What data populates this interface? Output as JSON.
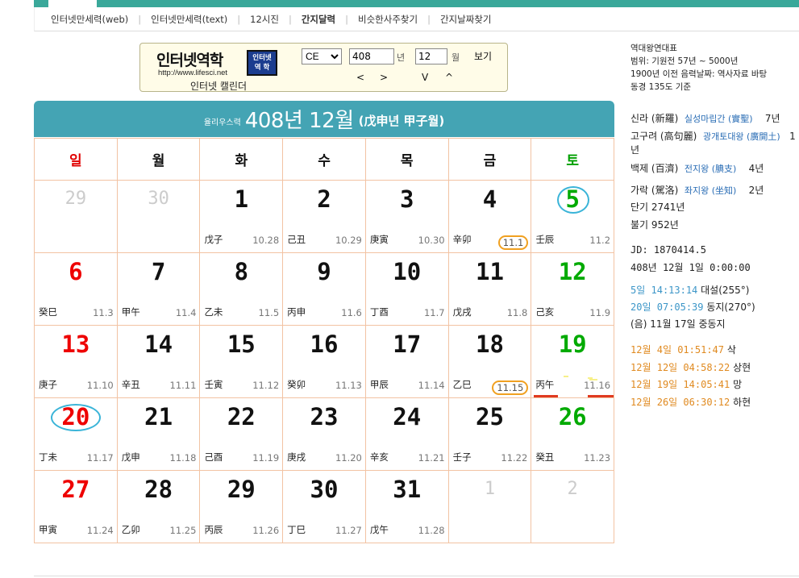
{
  "nav": [
    "인터넷만세력(web)",
    "인터넷만세력(text)",
    "12시진",
    "간지달력",
    "비슷한사주찾기",
    "간지날짜찾기"
  ],
  "logo": {
    "title": "인터넷역학",
    "url": "http://www.lifesci.net",
    "subtitle": "인터넷 캘린더",
    "stamp_line1": "인터넷",
    "stamp_line2": "역 학"
  },
  "controls": {
    "era": "CE",
    "year": "408",
    "year_label": "년",
    "month": "12",
    "month_label": "월",
    "view_button": "보기",
    "prev": "<",
    "next": ">",
    "down": "V",
    "up": "^"
  },
  "header": {
    "era": "율리우스력",
    "title": "408년 12월",
    "ganzhi": "(戊申년 甲子월)"
  },
  "weekdays": [
    "일",
    "월",
    "화",
    "수",
    "목",
    "금",
    "토"
  ],
  "weekday_colors": {
    "sun": "#e00000",
    "sat": "#00a000",
    "other": "#111111"
  },
  "weeks": [
    [
      {
        "d": "29",
        "o": true
      },
      {
        "d": "30",
        "o": true
      },
      {
        "d": "1",
        "gz": "戊子",
        "ld": "10.28"
      },
      {
        "d": "2",
        "gz": "己丑",
        "ld": "10.29"
      },
      {
        "d": "3",
        "gz": "庚寅",
        "ld": "10.30"
      },
      {
        "d": "4",
        "gz": "辛卯",
        "ld": "11.1",
        "mark": true
      },
      {
        "d": "5",
        "gz": "壬辰",
        "ld": "11.2",
        "circle": true
      }
    ],
    [
      {
        "d": "6",
        "gz": "癸巳",
        "ld": "11.3"
      },
      {
        "d": "7",
        "gz": "甲午",
        "ld": "11.4"
      },
      {
        "d": "8",
        "gz": "乙未",
        "ld": "11.5"
      },
      {
        "d": "9",
        "gz": "丙申",
        "ld": "11.6"
      },
      {
        "d": "10",
        "gz": "丁酉",
        "ld": "11.7"
      },
      {
        "d": "11",
        "gz": "戊戌",
        "ld": "11.8"
      },
      {
        "d": "12",
        "gz": "己亥",
        "ld": "11.9"
      }
    ],
    [
      {
        "d": "13",
        "gz": "庚子",
        "ld": "11.10"
      },
      {
        "d": "14",
        "gz": "辛丑",
        "ld": "11.11"
      },
      {
        "d": "15",
        "gz": "壬寅",
        "ld": "11.12"
      },
      {
        "d": "16",
        "gz": "癸卯",
        "ld": "11.13"
      },
      {
        "d": "17",
        "gz": "甲辰",
        "ld": "11.14"
      },
      {
        "d": "18",
        "gz": "乙巳",
        "ld": "11.15",
        "mark": true
      },
      {
        "d": "19",
        "gz": "丙午",
        "ld": "11.16",
        "redline": true
      }
    ],
    [
      {
        "d": "20",
        "gz": "丁未",
        "ld": "11.17",
        "circle": true
      },
      {
        "d": "21",
        "gz": "戊申",
        "ld": "11.18"
      },
      {
        "d": "22",
        "gz": "己酉",
        "ld": "11.19"
      },
      {
        "d": "23",
        "gz": "庚戌",
        "ld": "11.20"
      },
      {
        "d": "24",
        "gz": "辛亥",
        "ld": "11.21"
      },
      {
        "d": "25",
        "gz": "壬子",
        "ld": "11.22"
      },
      {
        "d": "26",
        "gz": "癸丑",
        "ld": "11.23"
      }
    ],
    [
      {
        "d": "27",
        "gz": "甲寅",
        "ld": "11.24"
      },
      {
        "d": "28",
        "gz": "乙卯",
        "ld": "11.25"
      },
      {
        "d": "29",
        "gz": "丙辰",
        "ld": "11.26"
      },
      {
        "d": "30",
        "gz": "丁巳",
        "ld": "11.27"
      },
      {
        "d": "31",
        "gz": "戊午",
        "ld": "11.28"
      },
      {
        "d": "1",
        "o": true
      },
      {
        "d": "2",
        "o": true
      }
    ]
  ],
  "info": {
    "line1": "역대왕연대표",
    "line2": "범위: 기원전 57년 ~ 5000년",
    "line3": "1900년 이전 음력날짜: 역사자료 바탕",
    "line4": "동경 135도 기준"
  },
  "kingdoms": [
    {
      "name": "신라 (新羅)",
      "king": "실성마립간 (實聖)",
      "year": "7년"
    },
    {
      "name": "고구려 (高句麗)",
      "king": "광개토대왕 (廣開土)",
      "year": "1",
      "year_wrap": "년"
    },
    {
      "name": "백제 (百濟)",
      "king": "전지왕 (腆支)",
      "year": "4년"
    },
    {
      "name": "가락 (駕洛)",
      "king": "좌지왕 (坐知)",
      "year": "2년"
    }
  ],
  "dangi": "단기 2741년",
  "bulgi": "불기 952년",
  "jd": "JD: 1870414.5",
  "jd_date": "408년 12월 1일 0:00:00",
  "solar_terms": [
    {
      "date": "5일 14:13:14",
      "name": "대설(255°)"
    },
    {
      "date": "20일 07:05:39",
      "name": "동지(270°)"
    }
  ],
  "lunar_note": "(음) 11월 17일 중동지",
  "moon_phases": [
    {
      "date": "12월 4일 01:51:47",
      "name": "삭"
    },
    {
      "date": "12월 12일 04:58:22",
      "name": "상현"
    },
    {
      "date": "12월 19일 14:05:41",
      "name": "망"
    },
    {
      "date": "12월 26일 06:30:12",
      "name": "하현"
    }
  ]
}
